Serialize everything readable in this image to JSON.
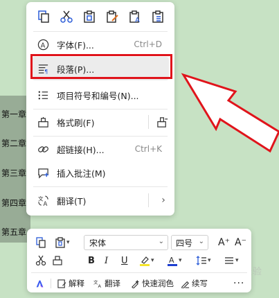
{
  "document": {
    "chapters": [
      "第一章",
      "第二章",
      "第三章",
      "第四章",
      "第五章"
    ],
    "watermark": "Baidu经验"
  },
  "context_menu": {
    "quick_icons": [
      "copy-icon",
      "cut-icon",
      "paste-icon",
      "paste-format-icon",
      "paste-text-icon",
      "paste-list-icon"
    ],
    "items": [
      {
        "label": "字体(F)...",
        "shortcut": "Ctrl+D",
        "icon": "font-icon"
      },
      {
        "label": "段落(P)...",
        "shortcut": "",
        "icon": "paragraph-icon",
        "highlighted": true
      },
      {
        "label": "项目符号和编号(N)...",
        "shortcut": "",
        "icon": "bullet-list-icon"
      },
      {
        "label": "格式刷(F)",
        "shortcut": "",
        "icon": "format-painter-icon"
      },
      {
        "label": "超链接(H)...",
        "shortcut": "Ctrl+K",
        "icon": "link-icon"
      },
      {
        "label": "插入批注(M)",
        "shortcut": "",
        "icon": "comment-icon"
      },
      {
        "label": "翻译(T)",
        "shortcut": "",
        "icon": "translate-icon"
      }
    ],
    "highlight_color": "#e0141b"
  },
  "toolbar": {
    "font_name": "宋体",
    "font_size": "四号",
    "grow_font": "A⁺",
    "shrink_font": "A⁻",
    "bold": "B",
    "italic": "I",
    "underline": "U",
    "highlight_color": "#f5e52a",
    "font_color": "#1e3fd0",
    "ai_items": [
      {
        "label": "解释",
        "icon": "explain-icon"
      },
      {
        "label": "翻译",
        "icon": "translate-small-icon"
      },
      {
        "label": "快速润色",
        "icon": "polish-icon"
      },
      {
        "label": "续写",
        "icon": "continue-write-icon"
      }
    ],
    "more": "···"
  }
}
